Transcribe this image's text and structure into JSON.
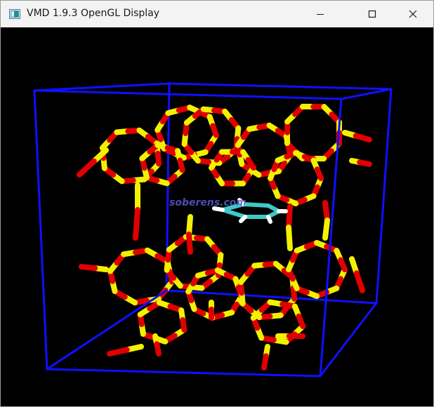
{
  "window": {
    "title": "VMD 1.9.3 OpenGL Display",
    "app_icon": "vmd-app-icon"
  },
  "controls": {
    "minimize": "minimize-icon",
    "maximize": "maximize-icon",
    "close": "close-icon"
  },
  "scene": {
    "background_color": "#000000",
    "box_color": "#1010ff",
    "oxygen_color": "#e00000",
    "silicon_color": "#f2f200",
    "guest_carbon_color": "#40c8c8",
    "guest_hydrogen_color": "#ffffff",
    "watermark": "soberens.com"
  }
}
